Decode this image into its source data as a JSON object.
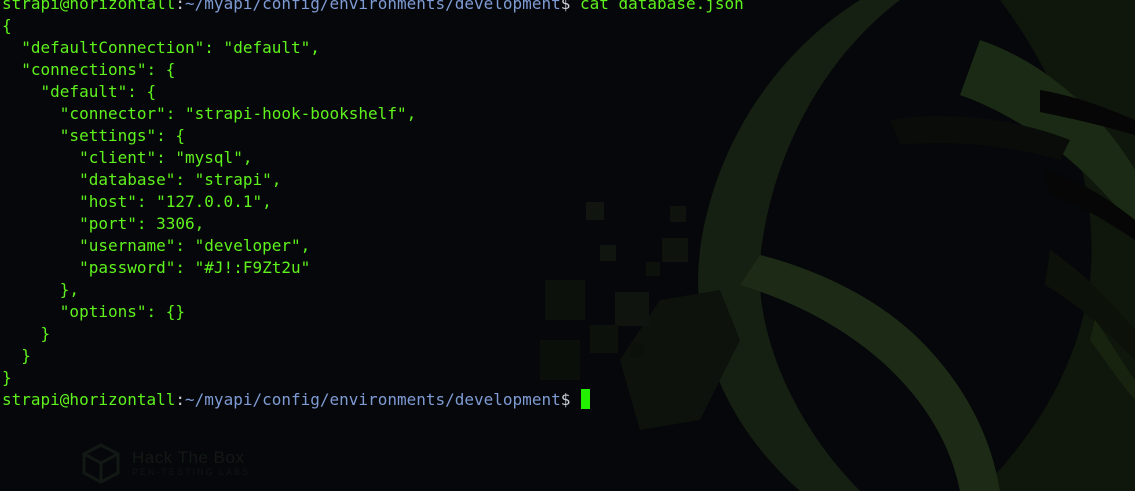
{
  "wallpaper": {
    "logo_icon": "cube-icon",
    "brand_title": "Hack The Box",
    "brand_subtitle": "PEN-TESTING LABS"
  },
  "prompt": {
    "user_host": "strapi@horizontall",
    "separator": ":",
    "path": "~/myapi/config/environments/development",
    "sign": "$ "
  },
  "command": "cat database.json",
  "output": [
    "{",
    "  \"defaultConnection\": \"default\",",
    "  \"connections\": {",
    "    \"default\": {",
    "      \"connector\": \"strapi-hook-bookshelf\",",
    "      \"settings\": {",
    "        \"client\": \"mysql\",",
    "        \"database\": \"strapi\",",
    "        \"host\": \"127.0.0.1\",",
    "        \"port\": 3306,",
    "        \"username\": \"developer\",",
    "        \"password\": \"#J!:F9Zt2u\"",
    "      },",
    "      \"options\": {}",
    "    }",
    "  }",
    "}"
  ],
  "colors": {
    "background": "#05070a",
    "text_green": "#5ff21d",
    "path_blue": "#7f9bd4",
    "cursor_green": "#22f000"
  }
}
